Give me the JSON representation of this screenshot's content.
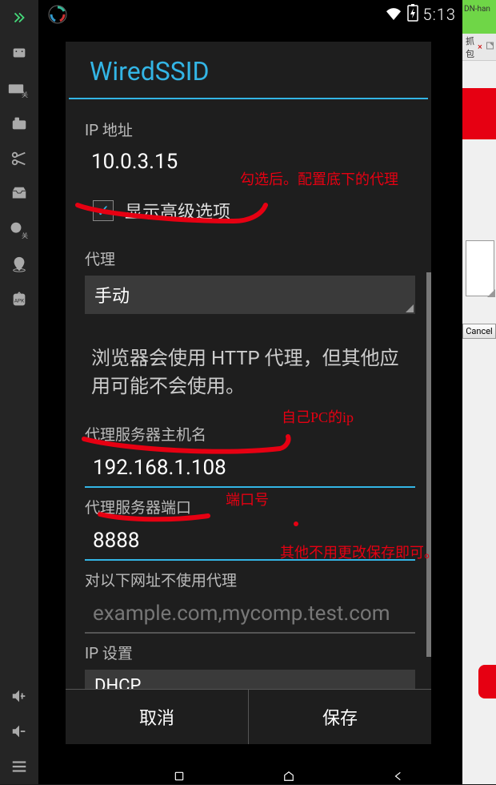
{
  "status_bar": {
    "time": "5:13"
  },
  "left_sidebar": {
    "badge_off": "关"
  },
  "dialog": {
    "title": "WiredSSID",
    "ip_label": "IP 地址",
    "ip_value": "10.0.3.15",
    "advanced_label": "显示高级选项",
    "advanced_checked": true,
    "proxy_label": "代理",
    "proxy_value": "手动",
    "proxy_info": "浏览器会使用 HTTP 代理，但其他应用可能不会使用。",
    "host_label": "代理服务器主机名",
    "host_value": "192.168.1.108",
    "port_label": "代理服务器端口",
    "port_value": "8888",
    "bypass_label": "对以下网址不使用代理",
    "bypass_placeholder": "example.com,mycomp.test.com",
    "ip_settings_label": "IP 设置",
    "ip_settings_value": "DHCP",
    "cancel": "取消",
    "save": "保存"
  },
  "annotations": {
    "a1": "勾选后。配置底下的代理",
    "a2": "自己PC的ip",
    "a3": "端口号",
    "a4": "其他不用更改保存即可。"
  },
  "right_panel": {
    "top_text": "DN-han",
    "tab_text": "抓包",
    "tab_x": "×",
    "cancel": "Cancel"
  }
}
